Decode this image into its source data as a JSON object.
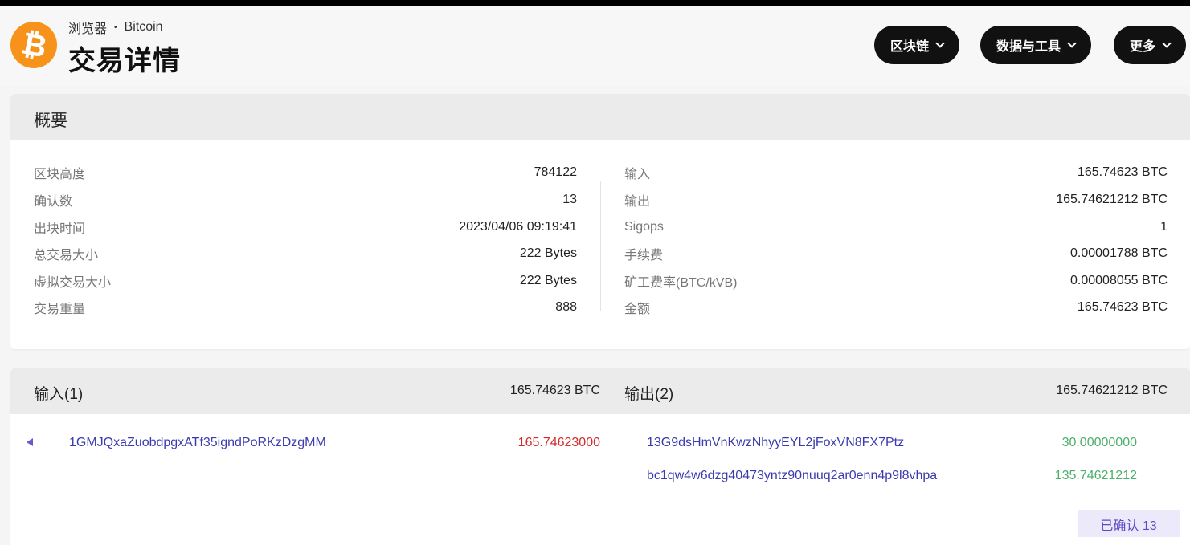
{
  "breadcrumb": {
    "section": "浏览器",
    "separator": "•",
    "chain": "Bitcoin"
  },
  "page_title": "交易详情",
  "nav": [
    "区块链",
    "数据与工具",
    "更多"
  ],
  "summary": {
    "title": "概要",
    "left": [
      {
        "label": "区块高度",
        "value": "784122"
      },
      {
        "label": "确认数",
        "value": "13"
      },
      {
        "label": "出块时间",
        "value": "2023/04/06 09:19:41"
      },
      {
        "label": "总交易大小",
        "value": "222 Bytes"
      },
      {
        "label": "虚拟交易大小",
        "value": "222 Bytes"
      },
      {
        "label": "交易重量",
        "value": "888"
      }
    ],
    "right": [
      {
        "label": "输入",
        "value": "165.74623 BTC"
      },
      {
        "label": "输出",
        "value": "165.74621212 BTC"
      },
      {
        "label": "Sigops",
        "value": "1"
      },
      {
        "label": "手续费",
        "value": "0.00001788 BTC"
      },
      {
        "label": "矿工费率(BTC/kVB)",
        "value": "0.00008055 BTC"
      },
      {
        "label": "金额",
        "value": "165.74623 BTC"
      }
    ]
  },
  "io": {
    "inputs_label": "输入(1)",
    "inputs_total": "165.74623 BTC",
    "outputs_label": "输出(2)",
    "outputs_total": "165.74621212 BTC",
    "inputs": [
      {
        "address": "1GMJQxaZuobdpgxATf35igndPoRKzDzgMM",
        "amount": "165.74623000"
      }
    ],
    "outputs": [
      {
        "address": "13G9dsHmVnKwzNhyyEYL2jFoxVN8FX7Ptz",
        "amount": "30.00000000"
      },
      {
        "address": "bc1qw4w6dzg40473yntz90nuuq2ar0enn4p9l8vhpa",
        "amount": "135.74621212"
      }
    ],
    "confirm_badge": "已确认 13"
  },
  "colors": {
    "input_amount": "#d42a2a",
    "output_amount": "#4caf6a",
    "address_link": "#3b3bb0",
    "brand": "#f7931a"
  }
}
